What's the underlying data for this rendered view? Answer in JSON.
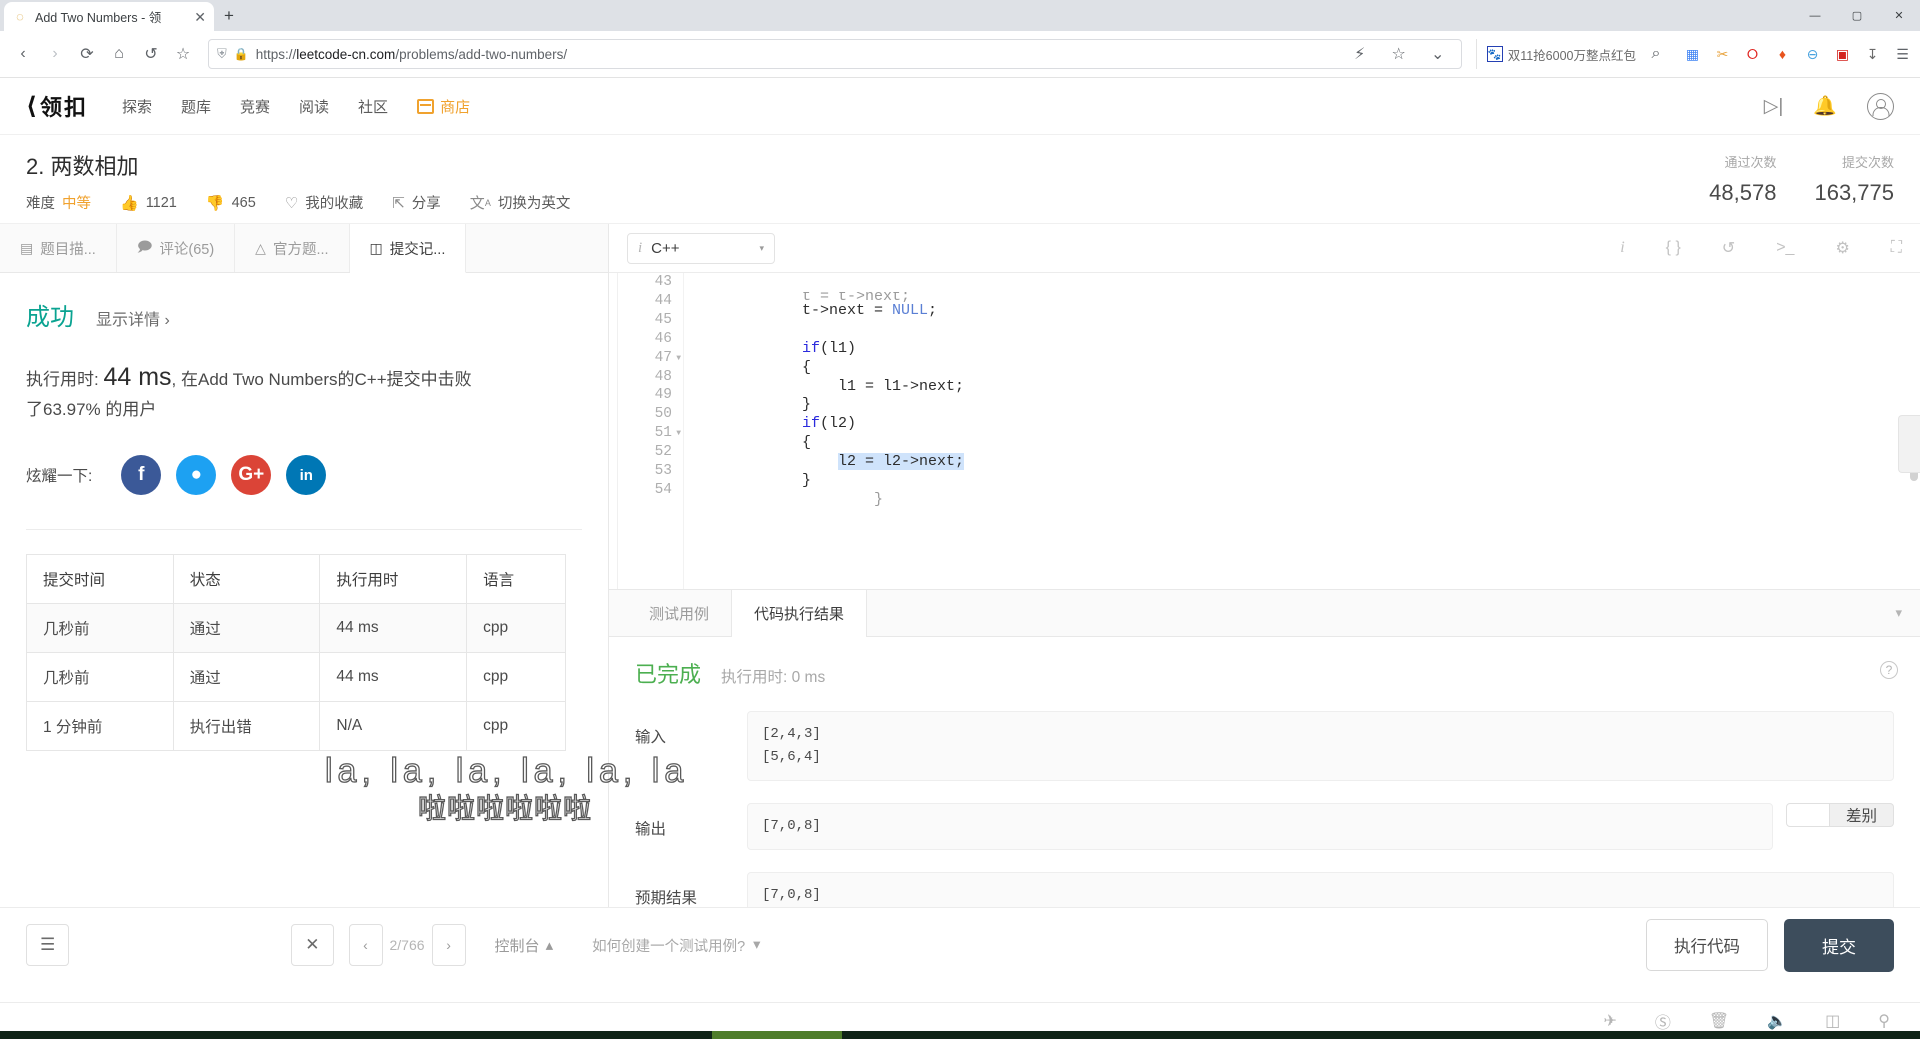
{
  "browser": {
    "tab": {
      "title": "Add Two Numbers - 领",
      "favicon": "leetcode-favicon",
      "close": "✕"
    },
    "new_tab": "+",
    "window_controls": {
      "minimize": "—",
      "maximize": "▢",
      "close": "✕"
    },
    "nav": {
      "back": "‹",
      "forward": "›",
      "reload": "⟳",
      "home": "⌂",
      "undo": "↺",
      "bookmark": "☆"
    },
    "url": {
      "protocol": "https://",
      "host": "leetcode-cn.com",
      "path": "/problems/add-two-numbers/",
      "lock": "🔒",
      "shield": "⛨"
    },
    "url_right": {
      "lightning": "⚡",
      "star": "☆",
      "chevron": "⌄"
    },
    "search_pill": {
      "icon_label": "baidu-icon",
      "text": "双11抢6000万整点红包",
      "search": "⌕"
    },
    "extensions": [
      "grid-icon",
      "scissors-icon",
      "opera-icon",
      "flame-icon",
      "minus-circle-icon",
      "qq-icon",
      "download-icon",
      "menu-icon"
    ]
  },
  "lc_nav": {
    "logo_mark": "⟨",
    "logo_text": "领扣",
    "items": [
      "探索",
      "题库",
      "竞赛",
      "阅读",
      "社区"
    ],
    "shop": "商店",
    "right_icons": [
      "play-code-icon",
      "bell-icon",
      "account-icon"
    ]
  },
  "problem": {
    "title": "2. 两数相加",
    "difficulty_label": "难度",
    "difficulty": "中等",
    "likes": "1121",
    "dislikes": "465",
    "favorite": "我的收藏",
    "share": "分享",
    "translate": "切换为英文",
    "stats": [
      {
        "label": "通过次数",
        "value": "48,578"
      },
      {
        "label": "提交次数",
        "value": "163,775"
      }
    ]
  },
  "left_tabs": [
    {
      "label": "题目描...",
      "icon": "description-icon",
      "active": false
    },
    {
      "label": "评论(65)",
      "icon": "comment-icon",
      "active": false
    },
    {
      "label": "官方题...",
      "icon": "flask-icon",
      "active": false
    },
    {
      "label": "提交记...",
      "icon": "submission-icon",
      "active": true
    }
  ],
  "result_summary": {
    "status": "成功",
    "detail_link": "显示详情",
    "chevron": "›",
    "runtime_prefix": "执行用时: ",
    "runtime_value": "44 ms",
    "runtime_suffix": ", 在Add Two Numbers的C++提交中击败了63.97% 的用户",
    "share_label": "炫耀一下:",
    "share_buttons": [
      "f",
      "🐦",
      "G+",
      "in"
    ]
  },
  "submissions_table": {
    "headers": [
      "提交时间",
      "状态",
      "执行用时",
      "语言"
    ],
    "rows": [
      {
        "time": "几秒前",
        "status": "通过",
        "status_type": "pass",
        "runtime": "44 ms",
        "lang": "cpp"
      },
      {
        "time": "几秒前",
        "status": "通过",
        "status_type": "pass",
        "runtime": "44 ms",
        "lang": "cpp"
      },
      {
        "time": "1 分钟前",
        "status": "执行出错",
        "status_type": "error",
        "runtime": "N/A",
        "lang": "cpp"
      }
    ]
  },
  "editor": {
    "lang_info_icon": "i",
    "language": "C++",
    "caret": "▾",
    "tools": [
      "info-icon",
      "format-braces-icon",
      "reset-icon",
      "console-icon",
      "settings-icon",
      "fullscreen-icon"
    ],
    "lines": [
      {
        "num": "43",
        "fold": false,
        "text": "t = t->next;",
        "partial": true
      },
      {
        "num": "44",
        "fold": false,
        "text": "t->next = NULL;"
      },
      {
        "num": "45",
        "fold": false,
        "text": ""
      },
      {
        "num": "46",
        "fold": false,
        "text": "if(l1)"
      },
      {
        "num": "47",
        "fold": true,
        "text": "{"
      },
      {
        "num": "48",
        "fold": false,
        "text": "    l1 = l1->next;"
      },
      {
        "num": "49",
        "fold": false,
        "text": "}"
      },
      {
        "num": "50",
        "fold": false,
        "text": "if(l2)"
      },
      {
        "num": "51",
        "fold": true,
        "text": "{"
      },
      {
        "num": "52",
        "fold": false,
        "text": "    l2 = l2->next;",
        "selected": true
      },
      {
        "num": "53",
        "fold": false,
        "text": "}"
      },
      {
        "num": "54",
        "fold": false,
        "text": ""
      }
    ]
  },
  "result_tabs": [
    {
      "label": "测试用例",
      "active": false
    },
    {
      "label": "代码执行结果",
      "active": true
    }
  ],
  "result_panel": {
    "status": "已完成",
    "runtime": "执行用时: 0 ms",
    "help": "?",
    "input_label": "输入",
    "input_value": "[2,4,3]\n[5,6,4]",
    "output_label": "输出",
    "output_value": "[7,0,8]",
    "diff_label": "差别",
    "expected_label": "预期结果",
    "expected_value": "[7,0,8]"
  },
  "bottom_bar": {
    "list_icon": "☰",
    "shuffle_icon": "✕",
    "prev_arrow": "‹",
    "next_arrow": "›",
    "pager_text": "2/766",
    "console_label": "控制台",
    "console_caret": "▴",
    "howto": "如何创建一个测试用例?",
    "howto_caret": "▾",
    "run_button": "执行代码",
    "submit_button": "提交"
  },
  "danmaku": {
    "line1": "la, la, la, la, la, la",
    "line2": "啦啦啦啦啦啦"
  },
  "player_bar": {
    "icons": [
      "rocket-icon",
      "no-sound-icon",
      "trash-icon",
      "volume-icon",
      "window-icon",
      "search-icon"
    ]
  },
  "colors": {
    "accent_orange": "#f0a22e",
    "pass_green": "#12a89d",
    "error_red": "#e8554d",
    "submit_navy": "#3d4d5c",
    "success_teal": "#0aa391",
    "complete_green": "#4caf50"
  }
}
